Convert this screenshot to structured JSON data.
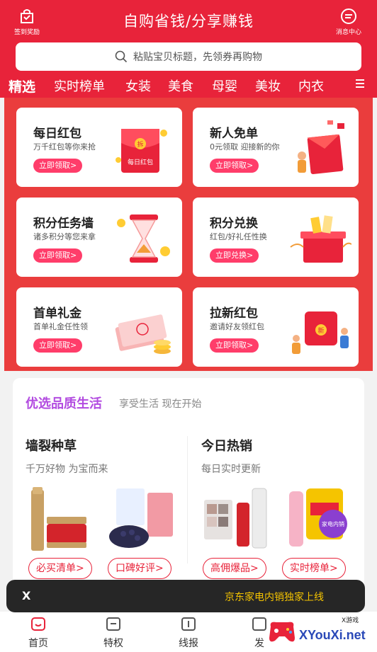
{
  "header": {
    "left_label": "签到奖励",
    "title": "自购省钱/分享赚钱",
    "right_label": "消息中心",
    "search_placeholder": "粘贴宝贝标题，先领券再购物"
  },
  "tabs": [
    {
      "label": "精选",
      "active": true
    },
    {
      "label": "实时榜单",
      "active": false
    },
    {
      "label": "女装",
      "active": false
    },
    {
      "label": "美食",
      "active": false
    },
    {
      "label": "母婴",
      "active": false
    },
    {
      "label": "美妆",
      "active": false
    },
    {
      "label": "内衣",
      "active": false
    }
  ],
  "cards": [
    {
      "title": "每日红包",
      "subtitle": "万千红包等你来抢",
      "button": "立即领取>",
      "art_label": "每日红包",
      "art_badge": "拆"
    },
    {
      "title": "新人免单",
      "subtitle": "0元领取 迎接新的你",
      "button": "立即领取>"
    },
    {
      "title": "积分任务墙",
      "subtitle": "诸多积分等您来拿",
      "button": "立即领取>"
    },
    {
      "title": "积分兑换",
      "subtitle": "红包/好礼任性换",
      "button": "立即兑换>"
    },
    {
      "title": "首单礼金",
      "subtitle": "首单礼金任性领",
      "button": "立即领取>"
    },
    {
      "title": "拉新红包",
      "subtitle": "邀请好友领红包",
      "button": "立即领取>",
      "art_badge": "新"
    }
  ],
  "quality": {
    "title": "优选品质生活",
    "subtitle": "享受生活 现在开始"
  },
  "columns": [
    {
      "title": "墙裂种草",
      "subtitle": "千万好物 为宝而来",
      "pills": [
        "必买清单>",
        "口碑好评>"
      ]
    },
    {
      "title": "今日热销",
      "subtitle": "每日实时更新",
      "pills": [
        "高佣爆品>",
        "实时榜单>"
      ],
      "badge_text": "家电内销"
    }
  ],
  "toast": {
    "close": "X",
    "message": "京东家电内销独家上线"
  },
  "nav": [
    {
      "label": "首页"
    },
    {
      "label": "特权"
    },
    {
      "label": "线报"
    },
    {
      "label": "发"
    }
  ],
  "watermark": {
    "text": "XYouXi.net",
    "small": "X游戏"
  },
  "colors": {
    "brand_red": "#e8233a",
    "panel_red": "#ea3d3d",
    "button_pink": "#ff3d6a",
    "quality_purple": "#b24be0",
    "toast_bg": "#262626",
    "toast_text": "#f5c400"
  }
}
